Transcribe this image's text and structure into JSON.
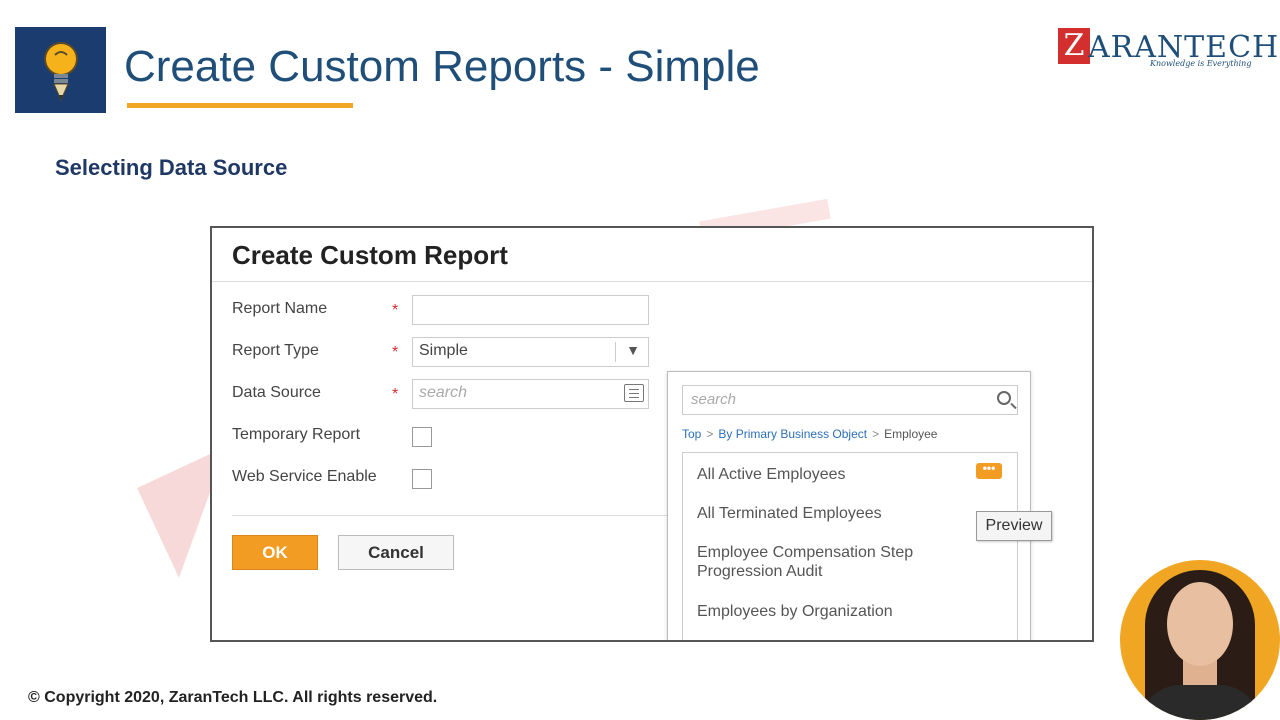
{
  "slide": {
    "title": "Create Custom Reports - Simple",
    "subtitle": "Selecting Data Source",
    "footer": "© Copyright 2020, ZaranTech LLC. All rights reserved."
  },
  "logo": {
    "mark": "Z",
    "name": "ARANTECH",
    "tagline": "Knowledge is Everything"
  },
  "dialog": {
    "title": "Create Custom Report",
    "fields": {
      "report_name": {
        "label": "Report Name",
        "value": "",
        "required_mark": "*"
      },
      "report_type": {
        "label": "Report Type",
        "value": "Simple",
        "required_mark": "*"
      },
      "data_source": {
        "label": "Data Source",
        "placeholder": "search",
        "required_mark": "*"
      },
      "temporary_report": {
        "label": "Temporary Report",
        "checked": false
      },
      "web_service_enable": {
        "label": "Web Service Enable",
        "checked": false
      }
    },
    "ok_label": "OK",
    "cancel_label": "Cancel"
  },
  "popup": {
    "search_placeholder": "search",
    "breadcrumb": [
      "Top",
      "By Primary Business Object",
      "Employee"
    ],
    "breadcrumb_sep": ">",
    "items": [
      "All Active Employees",
      "All Terminated Employees",
      "Employee Compensation Step Progression Audit",
      "Employees by Organization"
    ],
    "more_label": "•••",
    "preview_label": "Preview"
  },
  "colors": {
    "title": "#1f4e79",
    "accent_orange": "#f0a623",
    "ok_button": "#f39c24",
    "required": "#d32f2f",
    "link": "#2c6fb7"
  },
  "icons": [
    "lightbulb-icon",
    "search-icon",
    "list-icon",
    "chevron-down-icon",
    "more-icon"
  ]
}
